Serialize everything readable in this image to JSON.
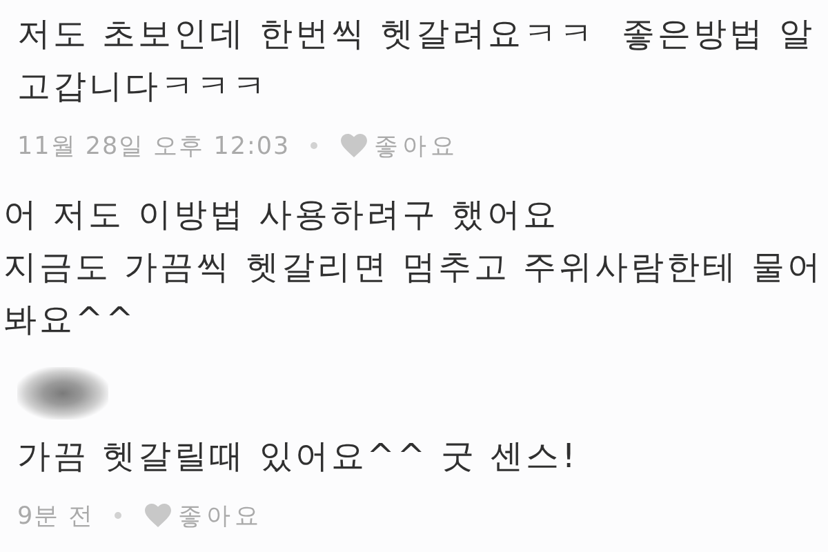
{
  "comments": [
    {
      "kind": "comment",
      "author_blurred": false,
      "lines": [
        "저도 초보인데 한번씩 헷갈려요ㅋㅋ  좋은방법 알",
        "고갑니다ㅋㅋㅋ"
      ],
      "time": "11월 28일 오후 12:03",
      "like": {
        "label": "좋아요",
        "liked": false
      }
    },
    {
      "kind": "continuation",
      "author_blurred": false,
      "lines": [
        "어 저도 이방법 사용하려구 했어요",
        "지금도 가끔씩 헷갈리면 멈추고 주위사람한테 물어",
        "봐요^^"
      ]
    },
    {
      "kind": "comment",
      "author_blurred": true,
      "lines": [
        "가끔 헷갈릴때 있어요^^ 굿 센스!"
      ],
      "time": "9분 전",
      "like": {
        "label": "좋아요",
        "liked": false
      }
    }
  ]
}
